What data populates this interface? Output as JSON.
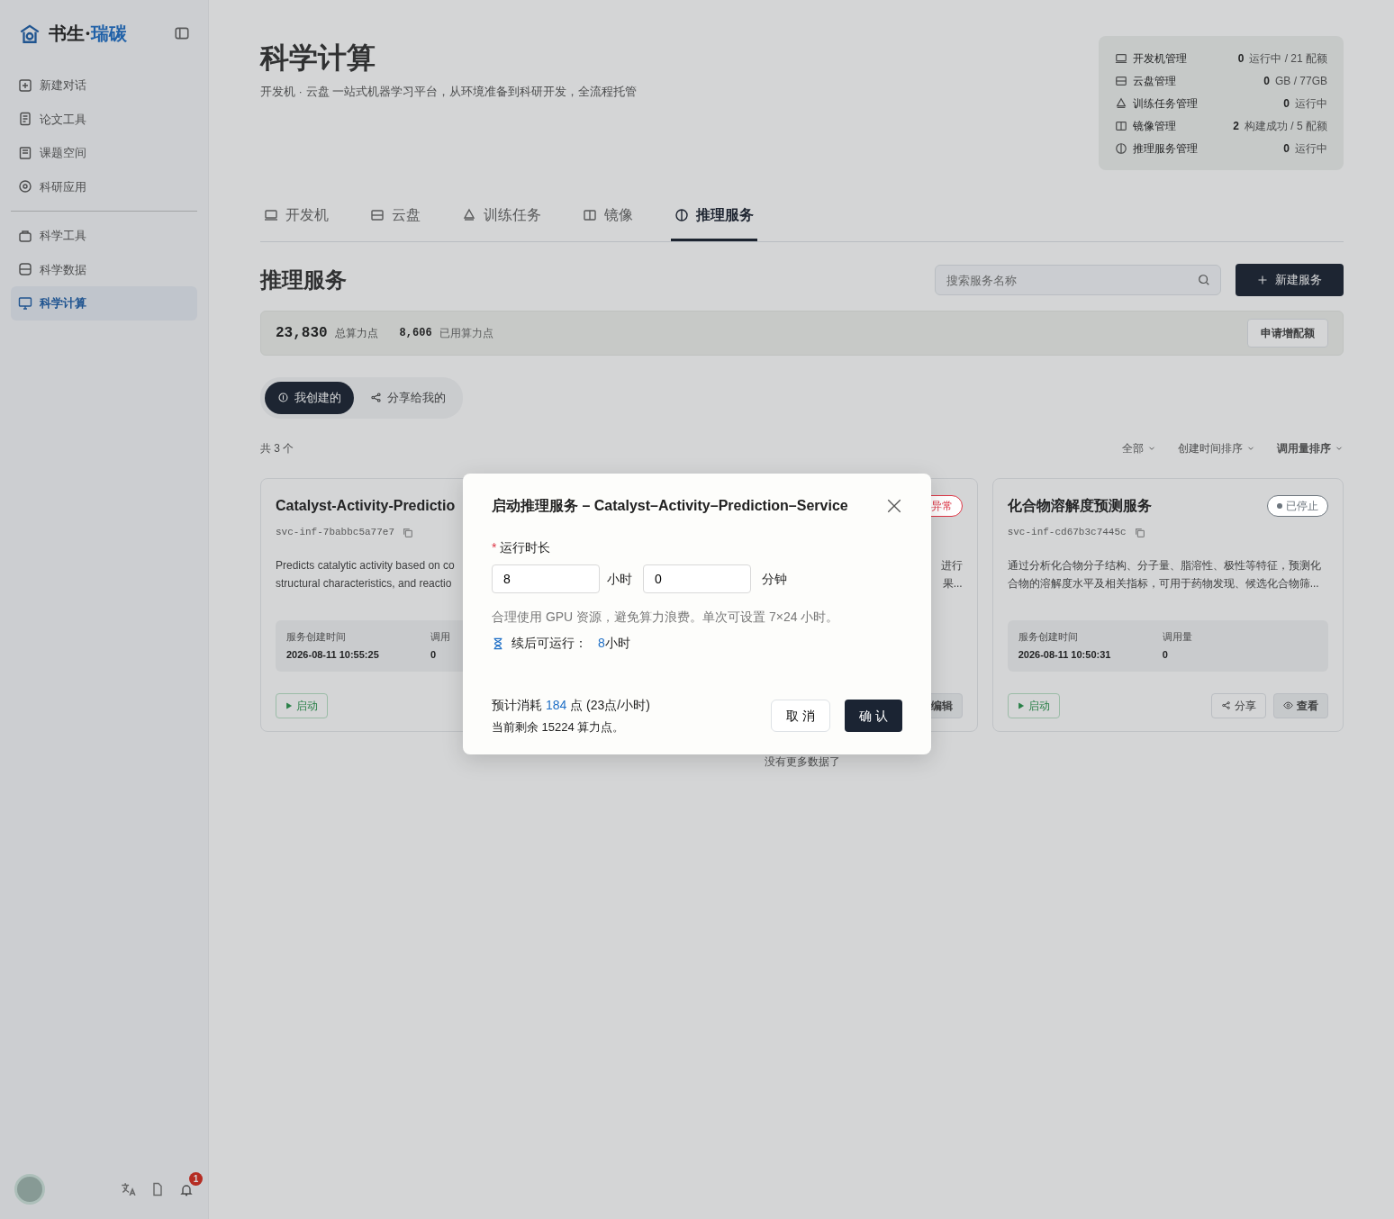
{
  "sidebar": {
    "logo_text": "书生·",
    "logo_accent": "瑞碳",
    "items": [
      {
        "label": "新建对话",
        "selected": false
      },
      {
        "label": "论文工具",
        "selected": false
      },
      {
        "label": "课题空间",
        "selected": false
      },
      {
        "label": "科研应用",
        "selected": false
      },
      {
        "label": "科学工具",
        "selected": false
      },
      {
        "label": "科学数据",
        "selected": false
      },
      {
        "label": "科学计算",
        "selected": true
      }
    ],
    "notification_count": "1"
  },
  "header": {
    "title": "科学计算",
    "subtitle": "开发机 · 云盘 一站式机器学习平台，从环境准备到科研开发，全流程托管"
  },
  "stats": [
    {
      "label": "开发机管理",
      "value": "0",
      "detail": "运行中 / 21 配额"
    },
    {
      "label": "云盘管理",
      "value": "0",
      "detail": "GB / 77GB"
    },
    {
      "label": "训练任务管理",
      "value": "0",
      "detail": "运行中"
    },
    {
      "label": "镜像管理",
      "value": "2",
      "detail": "构建成功 / 5 配额"
    },
    {
      "label": "推理服务管理",
      "value": "0",
      "detail": "运行中"
    }
  ],
  "tabs": [
    {
      "label": "开发机",
      "selected": false
    },
    {
      "label": "云盘",
      "selected": false
    },
    {
      "label": "训练任务",
      "selected": false
    },
    {
      "label": "镜像",
      "selected": false
    },
    {
      "label": "推理服务",
      "selected": true
    }
  ],
  "section": {
    "title": "推理服务",
    "search": {
      "placeholder": "搜索服务名称"
    },
    "new_button": "新建服务"
  },
  "quota": {
    "total": "23,830",
    "total_label": "总算力点",
    "used": "8,606",
    "used_label": "已用算力点",
    "apply_button": "申请增配额"
  },
  "segments": [
    {
      "label": "我创建的",
      "selected": true
    },
    {
      "label": "分享给我的",
      "selected": false
    }
  ],
  "list_bar": {
    "count": "共 3 个",
    "filter": "全部",
    "sort_time": "创建时间排序",
    "sort_calls": "调用量排序"
  },
  "cards": [
    {
      "title": "Catalyst-Activity-Predictio",
      "id": "svc-inf-7babbc5a77e7",
      "description": [
        "Predicts catalytic activity based on co",
        "structural characteristics, and reactio"
      ],
      "created_label": "服务创建时间",
      "created": "2026-08-11 10:55:25",
      "calls_label": "调用",
      "calls": "0",
      "start_button": "启动"
    },
    {
      "status": "异常",
      "color": "#dc3545",
      "description": [
        "进行",
        "果..."
      ],
      "edit_button": "编辑"
    },
    {
      "title": "化合物溶解度预测服务",
      "status": "已停止",
      "color": "#6c757d",
      "id": "svc-inf-cd67b3c7445c",
      "description": [
        "通过分析化合物分子结构、分子量、脂溶性、极性等特征，预测化",
        "合物的溶解度水平及相关指标，可用于药物发现、候选化合物筛..."
      ],
      "created_label": "服务创建时间",
      "created": "2026-08-11 10:50:31",
      "calls_label": "调用量",
      "calls": "0",
      "start_button": "启动",
      "share_button": "分享",
      "view_button": "查看"
    }
  ],
  "end_text": "没有更多数据了",
  "dialog": {
    "title": "启动推理服务 – Catalyst–Activity–Prediction–Service",
    "required_mark": "*",
    "field_label": "运行时长",
    "hours_value": "8",
    "hours_unit": "小时",
    "minutes_value": "0",
    "minutes_unit": "分钟",
    "hint": "合理使用 GPU 资源，避免算力浪费。单次可设置 7×24 小时。",
    "after_label": "续后可运行：",
    "after_value": "8",
    "after_unit": "小时",
    "cost_prefix": "预计消耗",
    "cost_value": "184",
    "cost_suffix": "点 (23点/小时)",
    "remaining": "当前剩余 15224 算力点。",
    "cancel_button": "取 消",
    "confirm_button": "确 认"
  }
}
